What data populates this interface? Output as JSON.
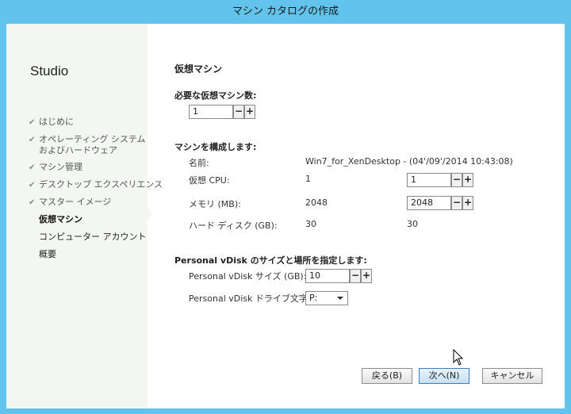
{
  "window": {
    "title": "マシン カタログの作成"
  },
  "sidebar": {
    "brand": "Studio",
    "items": [
      {
        "label": "はじめに",
        "state": "done"
      },
      {
        "label": "オペレーティング システム",
        "label2": "およびハードウェア",
        "state": "done"
      },
      {
        "label": "マシン管理",
        "state": "done"
      },
      {
        "label": "デスクトップ エクスペリエンス",
        "state": "done"
      },
      {
        "label": "マスター イメージ",
        "state": "done"
      },
      {
        "label": "仮想マシン",
        "state": "current"
      },
      {
        "label": "コンピューター アカウント",
        "state": "pending"
      },
      {
        "label": "概要",
        "state": "pending"
      }
    ]
  },
  "main": {
    "heading": "仮想マシン",
    "vm_count": {
      "label": "必要な仮想マシン数:",
      "value": "1"
    },
    "config": {
      "heading": "マシンを構成します:",
      "rows": [
        {
          "label": "名前:",
          "value": "Win7_for_XenDesktop - (04'/09'/2014 10:43:08)"
        },
        {
          "label": "仮想 CPU:",
          "master": "1",
          "input": "1"
        },
        {
          "label": "メモリ (MB):",
          "master": "2048",
          "input": "2048"
        },
        {
          "label": "ハード ディスク (GB):",
          "master": "30",
          "value": "30"
        }
      ]
    },
    "pvd": {
      "heading": "Personal vDisk のサイズと場所を指定します:",
      "size_label": "Personal vDisk サイズ (GB):",
      "size_value": "10",
      "drive_label": "Personal vDisk ドライブ文字:",
      "drive_value": "P:"
    },
    "stepper": {
      "minus": "−",
      "plus": "+"
    }
  },
  "footer": {
    "back": "戻る(B)",
    "next": "次へ(N)",
    "cancel": "キャンセル"
  },
  "colors": {
    "titlebar": "#62c4ec",
    "sidebar": "#f4f6f2",
    "primary_border": "#3d7bbf"
  }
}
